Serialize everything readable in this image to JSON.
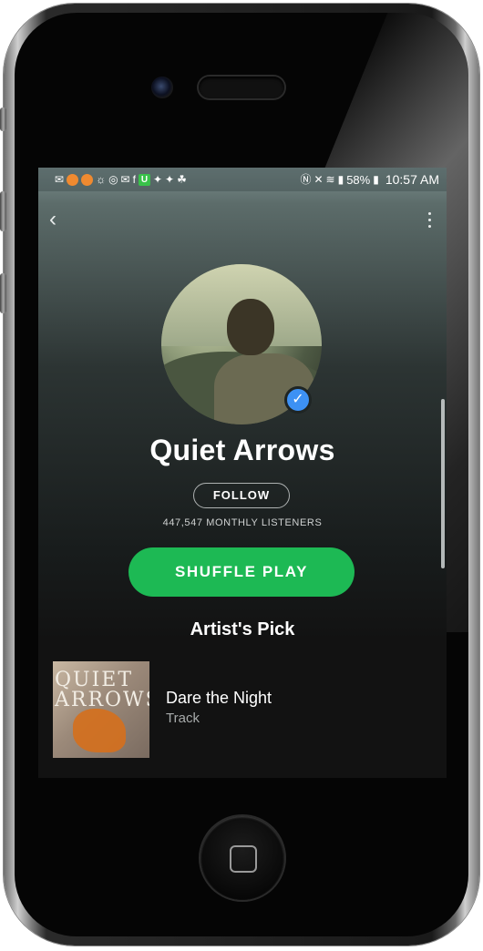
{
  "status_bar": {
    "battery": "58%",
    "time": "10:57 AM"
  },
  "artist": {
    "name": "Quiet Arrows",
    "follow_label": "FOLLOW",
    "listeners": "447,547 MONTHLY LISTENERS",
    "verified_icon": "checkmark-icon"
  },
  "actions": {
    "shuffle_play_label": "SHUFFLE PLAY"
  },
  "artists_pick": {
    "section_title": "Artist's Pick",
    "cover_text_line1": "QUIET",
    "cover_text_line2": "ARROWS",
    "title": "Dare the Night",
    "type": "Track"
  },
  "colors": {
    "accent_green": "#1db954",
    "verified_blue": "#3d91f4",
    "background": "#121212"
  },
  "icons": {
    "back": "chevron-left-icon",
    "more": "more-vertical-icon"
  }
}
